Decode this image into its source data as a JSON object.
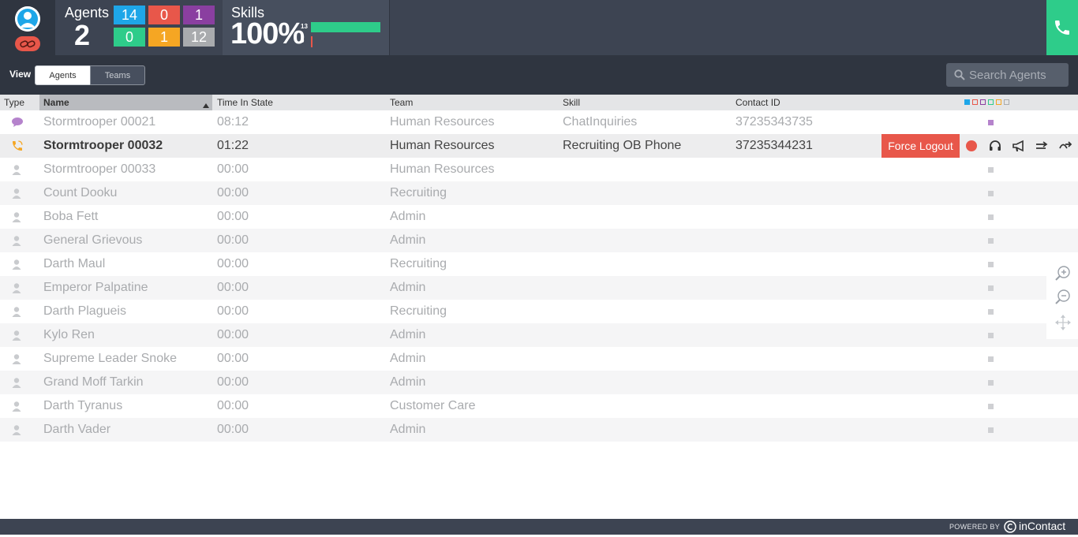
{
  "header": {
    "agents": {
      "title": "Agents",
      "count": "2",
      "tiles": [
        {
          "value": "14",
          "color": "#1ea6e8"
        },
        {
          "value": "0",
          "color": "#e8574a"
        },
        {
          "value": "1",
          "color": "#8a3fa0"
        },
        {
          "value": "0",
          "color": "#2ecc8a"
        },
        {
          "value": "1",
          "color": "#f5a623"
        },
        {
          "value": "12",
          "color": "#a9abae"
        }
      ]
    },
    "skills": {
      "title": "Skills",
      "percent": "100%",
      "bars": [
        {
          "label": "13",
          "value": 13,
          "color": "#2ecc8a"
        },
        {
          "label": "0",
          "value": 0,
          "color": "#e8574a"
        }
      ]
    },
    "icons": {
      "avatar": "agent-avatar-icon",
      "link": "unlink-icon",
      "phone": "phone-icon"
    }
  },
  "view": {
    "label": "View",
    "tabs": [
      {
        "label": "Agents",
        "selected": true
      },
      {
        "label": "Teams",
        "selected": false
      }
    ],
    "search_placeholder": "Search Agents"
  },
  "table": {
    "columns": [
      "Type",
      "Name",
      "Time In State",
      "Team",
      "Skill",
      "Contact ID"
    ],
    "sorted_column": "Name",
    "legend_colors": [
      "#1ea6e8",
      "#e8574a",
      "#8a3fa0",
      "#2ecc8a",
      "#f5a623",
      "#a9abae"
    ],
    "rows": [
      {
        "type": "chat",
        "name": "Stormtrooper 00021",
        "time": "08:12",
        "team": "Human Resources",
        "skill": "ChatInquiries",
        "contact_id": "37235343735",
        "state_color": "#b583cc"
      },
      {
        "type": "phone",
        "name": "Stormtrooper 00032",
        "time": "01:22",
        "team": "Human Resources",
        "skill": "Recruiting OB Phone",
        "contact_id": "37235344231",
        "active": true
      },
      {
        "type": "agent",
        "name": "Stormtrooper 00033",
        "time": "00:00",
        "team": "Human Resources",
        "skill": "",
        "contact_id": ""
      },
      {
        "type": "agent",
        "name": "Count Dooku",
        "time": "00:00",
        "team": "Recruiting",
        "skill": "",
        "contact_id": ""
      },
      {
        "type": "agent",
        "name": "Boba Fett",
        "time": "00:00",
        "team": "Admin",
        "skill": "",
        "contact_id": ""
      },
      {
        "type": "agent",
        "name": "General Grievous",
        "time": "00:00",
        "team": "Admin",
        "skill": "",
        "contact_id": ""
      },
      {
        "type": "agent",
        "name": "Darth Maul",
        "time": "00:00",
        "team": "Recruiting",
        "skill": "",
        "contact_id": ""
      },
      {
        "type": "agent",
        "name": "Emperor Palpatine",
        "time": "00:00",
        "team": "Admin",
        "skill": "",
        "contact_id": ""
      },
      {
        "type": "agent",
        "name": "Darth Plagueis",
        "time": "00:00",
        "team": "Recruiting",
        "skill": "",
        "contact_id": ""
      },
      {
        "type": "agent",
        "name": "Kylo Ren",
        "time": "00:00",
        "team": "Admin",
        "skill": "",
        "contact_id": ""
      },
      {
        "type": "agent",
        "name": "Supreme Leader Snoke",
        "time": "00:00",
        "team": "Admin",
        "skill": "",
        "contact_id": ""
      },
      {
        "type": "agent",
        "name": "Grand Moff Tarkin",
        "time": "00:00",
        "team": "Admin",
        "skill": "",
        "contact_id": ""
      },
      {
        "type": "agent",
        "name": "Darth Tyranus",
        "time": "00:00",
        "team": "Customer Care",
        "skill": "",
        "contact_id": ""
      },
      {
        "type": "agent",
        "name": "Darth Vader",
        "time": "00:00",
        "team": "Admin",
        "skill": "",
        "contact_id": ""
      }
    ],
    "active_row_actions": {
      "force_logout_label": "Force Logout",
      "icons": [
        "record-icon",
        "headset-monitor-icon",
        "barge-megaphone-icon",
        "transfer-icon",
        "redirect-icon"
      ]
    }
  },
  "zoom": {
    "icons": [
      "zoom-in-icon",
      "zoom-out-icon",
      "pan-icon"
    ]
  },
  "footer": {
    "powered_by": "POWERED BY",
    "brand": "inContact"
  }
}
